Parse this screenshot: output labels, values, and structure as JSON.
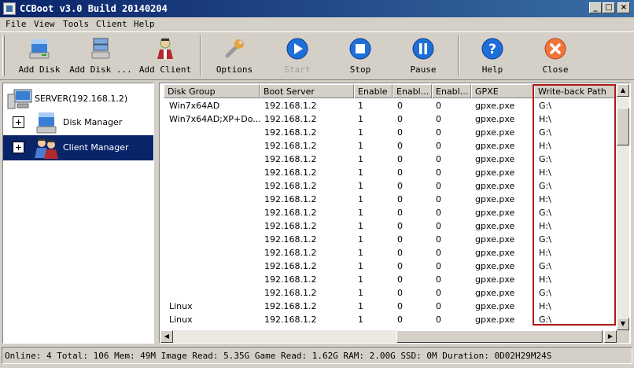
{
  "window": {
    "title": "CCBoot v3.0 Build 20140204",
    "minimize": "_",
    "maximize": "□",
    "close": "×"
  },
  "menu": [
    "File",
    "View",
    "Tools",
    "Client",
    "Help"
  ],
  "toolbar": {
    "add_disk": "Add Disk",
    "add_disk_group": "Add Disk ...",
    "add_client": "Add Client",
    "options": "Options",
    "start": "Start",
    "stop": "Stop",
    "pause": "Pause",
    "help": "Help",
    "close": "Close"
  },
  "colors": {
    "highlight_border": "#b01818",
    "selection": "#0a246a",
    "titlebar": "#0a246a"
  },
  "tree": {
    "root": {
      "label": "SERVER(192.168.1.2)",
      "icon": "computer-icon"
    },
    "nodes": [
      {
        "label": "Disk Manager",
        "icon": "disk-icon",
        "selected": false
      },
      {
        "label": "Client Manager",
        "icon": "users-icon",
        "selected": true
      }
    ]
  },
  "grid": {
    "columns": [
      "Disk Group",
      "Boot Server",
      "Enable",
      "Enabl...",
      "Enabl...",
      "GPXE",
      "Write-back Path"
    ],
    "rows": [
      [
        "Win7x64AD",
        "192.168.1.2",
        "1",
        "0",
        "0",
        "gpxe.pxe",
        "G:\\"
      ],
      [
        "Win7x64AD;XP+Do...",
        "192.168.1.2",
        "1",
        "0",
        "0",
        "gpxe.pxe",
        "H:\\"
      ],
      [
        "",
        "192.168.1.2",
        "1",
        "0",
        "0",
        "gpxe.pxe",
        "G:\\"
      ],
      [
        "",
        "192.168.1.2",
        "1",
        "0",
        "0",
        "gpxe.pxe",
        "H:\\"
      ],
      [
        "",
        "192.168.1.2",
        "1",
        "0",
        "0",
        "gpxe.pxe",
        "G:\\"
      ],
      [
        "",
        "192.168.1.2",
        "1",
        "0",
        "0",
        "gpxe.pxe",
        "H:\\"
      ],
      [
        "",
        "192.168.1.2",
        "1",
        "0",
        "0",
        "gpxe.pxe",
        "G:\\"
      ],
      [
        "",
        "192.168.1.2",
        "1",
        "0",
        "0",
        "gpxe.pxe",
        "H:\\"
      ],
      [
        "",
        "192.168.1.2",
        "1",
        "0",
        "0",
        "gpxe.pxe",
        "G:\\"
      ],
      [
        "",
        "192.168.1.2",
        "1",
        "0",
        "0",
        "gpxe.pxe",
        "H:\\"
      ],
      [
        "",
        "192.168.1.2",
        "1",
        "0",
        "0",
        "gpxe.pxe",
        "G:\\"
      ],
      [
        "",
        "192.168.1.2",
        "1",
        "0",
        "0",
        "gpxe.pxe",
        "H:\\"
      ],
      [
        "",
        "192.168.1.2",
        "1",
        "0",
        "0",
        "gpxe.pxe",
        "G:\\"
      ],
      [
        "",
        "192.168.1.2",
        "1",
        "0",
        "0",
        "gpxe.pxe",
        "H:\\"
      ],
      [
        "",
        "192.168.1.2",
        "1",
        "0",
        "0",
        "gpxe.pxe",
        "G:\\"
      ],
      [
        "Linux",
        "192.168.1.2",
        "1",
        "0",
        "0",
        "gpxe.pxe",
        "H:\\"
      ],
      [
        "Linux",
        "192.168.1.2",
        "1",
        "0",
        "0",
        "gpxe.pxe",
        "G:\\"
      ]
    ]
  },
  "status": "Online: 4 Total: 106 Mem: 49M Image Read: 5.35G Game Read: 1.62G RAM: 2.00G SSD: 0M Duration: 0D02H29M24S"
}
